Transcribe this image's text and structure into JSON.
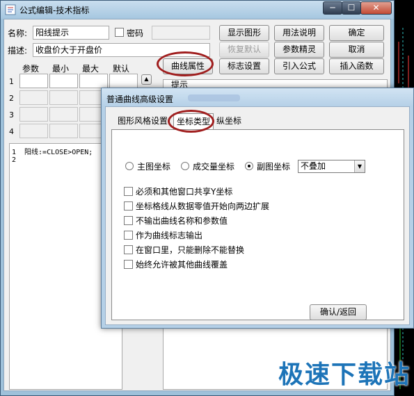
{
  "window": {
    "title": "公式编辑-技术指标",
    "minimize": "─",
    "maximize": "☐",
    "close": "✕"
  },
  "form": {
    "name_label": "名称:",
    "name_value": "阳线提示",
    "password_label": "密码",
    "desc_label": "描述:",
    "desc_value": "收盘价大于开盘价",
    "param_headers": [
      "参数",
      "最小",
      "最大",
      "默认"
    ],
    "row_numbers": [
      "1",
      "2",
      "3",
      "4"
    ]
  },
  "buttons": {
    "show_graph": "显示图形",
    "usage": "用法说明",
    "confirm": "确定",
    "restore_default": "恢复默认",
    "param_wizard": "参数精灵",
    "cancel": "取消",
    "curve_props": "曲线属性",
    "marker_settings": "标志设置",
    "import_formula": "引入公式",
    "insert_function": "插入函数"
  },
  "info_label": "提示",
  "editor": {
    "lines": [
      {
        "num": "1",
        "code": "阳线:=CLOSE>OPEN;"
      },
      {
        "num": "2",
        "code": ""
      }
    ]
  },
  "dialog": {
    "title": "普通曲线高级设置",
    "tabs": [
      "图形风格设置",
      "坐标类型",
      "纵坐标"
    ],
    "radios": [
      {
        "label": "主图坐标",
        "checked": false
      },
      {
        "label": "成交量坐标",
        "checked": false
      },
      {
        "label": "副图坐标",
        "checked": true
      }
    ],
    "overlay_select": "不叠加",
    "checkboxes": [
      "必须和其他窗口共享Y坐标",
      "坐标格线从数据零值开始向两边扩展",
      "不输出曲线名称和参数值",
      "作为曲线标志输出",
      "在窗口里，只能删除不能替换",
      "始终允许被其他曲线覆盖"
    ],
    "ok_button": "确认/返回"
  },
  "watermark": "极速下载站",
  "colors": {
    "highlight": "#a01e1e",
    "watermark": "#1d74b8",
    "title_bar": "#b5d0e7"
  }
}
